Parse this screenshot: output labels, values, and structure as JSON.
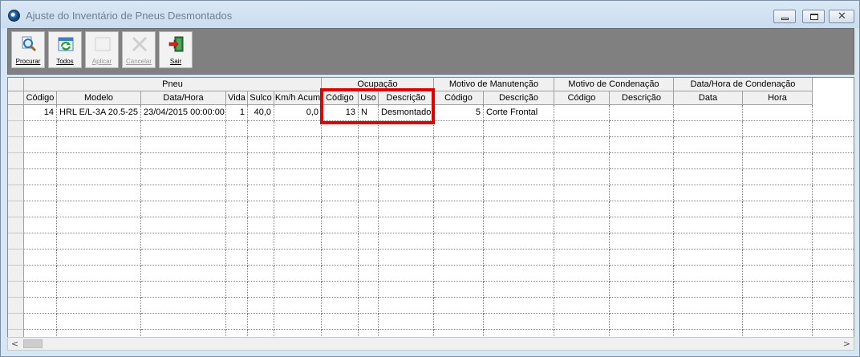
{
  "window": {
    "title": "Ajuste do Inventário de Pneus Desmontados",
    "close_glyph": "✕"
  },
  "toolbar": {
    "buttons": [
      {
        "label": "Procurar",
        "icon": "search-icon",
        "enabled": true
      },
      {
        "label": "Todos",
        "icon": "refresh-all-icon",
        "enabled": true
      },
      {
        "label": "Aplicar",
        "icon": "apply-icon",
        "enabled": false
      },
      {
        "label": "Cancelar",
        "icon": "cancel-icon",
        "enabled": false
      },
      {
        "label": "Sair",
        "icon": "exit-door-icon",
        "enabled": true
      }
    ]
  },
  "grid": {
    "groups": [
      "Pneu",
      "Ocupação",
      "Motivo de Manutenção",
      "Motivo de Condenação",
      "Data/Hora de Condenação"
    ],
    "columns": [
      "Código",
      "Modelo",
      "Data/Hora",
      "Vida",
      "Sulco",
      "Km/h Acum",
      "Código",
      "Uso",
      "Descrição",
      "Código",
      "Descrição",
      "Código",
      "Descrição",
      "Data",
      "Hora"
    ],
    "rows": [
      [
        "14",
        "HRL E/L-3A 20.5-25",
        "23/04/2015 00:00:00",
        "1",
        "40,0",
        "0,0",
        "13",
        "N",
        "Desmontado",
        "5",
        "Corte Frontal",
        "",
        "",
        "",
        ""
      ]
    ],
    "empty_row_count": 14
  },
  "scrollbar": {
    "left_arrow": "<",
    "right_arrow": ">"
  },
  "colors": {
    "highlight": "#e00000",
    "toolbar_bg": "#808080"
  }
}
